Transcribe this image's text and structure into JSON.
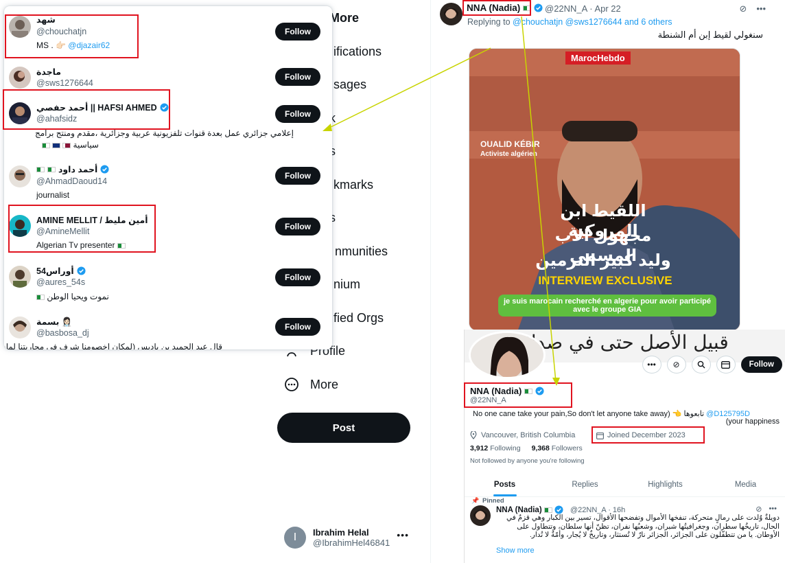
{
  "nav": {
    "items": [
      {
        "label": "More",
        "icon": "more-icon"
      },
      {
        "label": "Notifications",
        "icon": "bell-icon"
      },
      {
        "label": "Messages",
        "icon": "envelope-icon"
      },
      {
        "label": "Grok",
        "icon": "grok-icon"
      },
      {
        "label": "Lists",
        "icon": "list-icon"
      },
      {
        "label": "Bookmarks",
        "icon": "bookmark-icon"
      },
      {
        "label": "Jobs",
        "icon": "briefcase-icon"
      },
      {
        "label": "Communities",
        "icon": "people-icon"
      },
      {
        "label": "Premium",
        "icon": "x-icon"
      },
      {
        "label": "Verified Orgs",
        "icon": "lightning-icon"
      },
      {
        "label": "Profile",
        "icon": "person-icon"
      },
      {
        "label": "More",
        "icon": "ellipsis-circle-icon"
      }
    ],
    "visible": {
      "more_top": "More",
      "notifications": "ifications",
      "messages": "sages",
      "grok": "k",
      "lists": "s",
      "bookmarks": "kmarks",
      "jobs": "s",
      "communities": "nmunities",
      "premium": "nium",
      "verified_orgs": "fied Orgs",
      "profile": "Profile",
      "more": "More"
    },
    "post_label": "Post",
    "account": {
      "name": "Ibrahim Helal",
      "handle": "@IbrahimHel46841",
      "initial": "I"
    }
  },
  "popup": {
    "users": [
      {
        "name": "شهد",
        "handle": "@chouchatjn",
        "bio_prefix": "MS . 👉🏻 ",
        "bio_link": "@djazair62",
        "follow": "Follow"
      },
      {
        "name": "ماجدة",
        "handle": "@sws1276644",
        "follow": "Follow"
      },
      {
        "name": "أحمد حفصي || HAFSI AHMED",
        "handle": "@ahafsidz",
        "bio_line1": "إعلامي جزائري عمل بعدة قنوات تلفزيونية عربية وجزائرية ،مقدم ومنتج برامج",
        "bio_line2": "سياسية",
        "follow": "Follow"
      },
      {
        "name": "أحمد داود",
        "handle": "@AhmadDaoud14",
        "bio": "journalist",
        "follow": "Follow"
      },
      {
        "name": "AMINE MELLIT / أمين مليط",
        "handle": "@AmineMellit",
        "bio": "Algerian Tv presenter",
        "follow": "Follow"
      },
      {
        "name": "أوراس54",
        "handle": "@aures_54s",
        "bio": "نموت ويحيا الوطن",
        "follow": "Follow"
      },
      {
        "name": "بسمة 👩🏻‍⚕️",
        "handle": "@basbosa_dj",
        "bio": "قال عبد الحميد بن باديس (لمكان اخصومنا شرف في محاربتنا لمان الخطب)",
        "follow": "Follow"
      }
    ]
  },
  "tweet": {
    "author": "NNA (Nadia)",
    "handle": "@22NN_A",
    "date": "Apr 22",
    "replying_prefix": "Replying to",
    "replying_to": "@chouchatjn @sws1276644 and 6 others",
    "text": "سنغولي لقيط إبن أم الشنطة",
    "image": {
      "brand": "MarocHebdo",
      "person_name": "OUALID KÉBIR",
      "person_role": "Activiste algérien",
      "arabic_line1": "اللقيط ابن المروكية",
      "arabic_line2": "مجهول الاب المسمى",
      "arabic_line3": "وليد كبير الترمين",
      "headline": "INTERVIEW EXCLUSIVE",
      "quote": "je suis marocain recherché en algerie pour avoir participé avec le groupe GIA",
      "colors": {
        "bg": "#a94d35",
        "headline": "#ffd400",
        "quote_bg": "#5fbf3f",
        "brand_bg": "#d51e25"
      }
    }
  },
  "profile": {
    "banner_text": "قبيل الأصل حتى في صداقته",
    "name": "NNA (Nadia)",
    "handle": "@22NN_A",
    "follow": "Follow",
    "bio": "No one cane take your pain,So don't let anyone take away) 👈 تابعوها",
    "bio_link": "@D125795D",
    "bio_line2": "(your happiness",
    "location": "Vancouver, British Columbia",
    "joined": "Joined December 2023",
    "following_count": "3,912",
    "following_label": "Following",
    "followers_count": "9,368",
    "followers_label": "Followers",
    "not_followed": "Not followed by anyone you're following",
    "tabs": [
      "Posts",
      "Replies",
      "Highlights",
      "Media"
    ],
    "pinned_label": "Pinned",
    "pinned_post": {
      "name": "NNA (Nadia)",
      "meta": "@22NN_A · 16h",
      "text": "دويلةٌ وُلدت على رمالٍ متحركة، تنفخها الأموال وتفضحها الأقوال، تسير بين الكبار وهي قزمٌ في الحال، تاريخُها سطران، وجغرافيتُها شبران، وشعبُها نفران، تظنّ أنها سلطان، وتتطاول على الأوطان. يا من تتطفّلون على الجزائر، الجزائر نارٌ لا تُستثار، وتاريخٌ لا يُجار، وأمّةٌ لا تُدار.",
      "show_more": "Show more"
    }
  },
  "colors": {
    "accent": "#1d9bf0",
    "annotation_red": "#e0131f",
    "annotation_arrow": "#c8d400",
    "button_dark": "#0f1419"
  }
}
